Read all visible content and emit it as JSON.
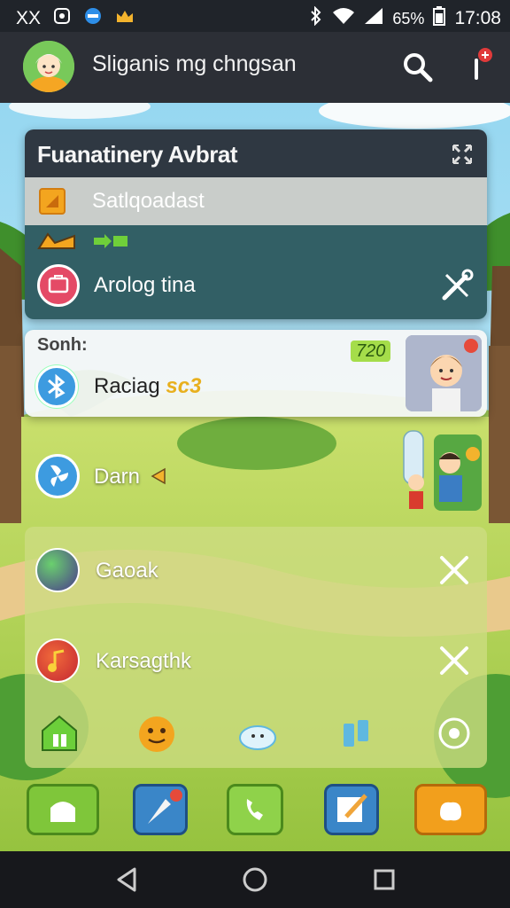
{
  "status_bar": {
    "carrier": "XX",
    "battery_percent": "65%",
    "time": "17:08"
  },
  "app_bar": {
    "title": "Sliganis mg chngsan",
    "search_icon": "search-icon",
    "more_icon": "more-vert-icon"
  },
  "panel_primary": {
    "title": "Fuanatinery Avbrat",
    "close_icon": "expand-collapse-icon",
    "subheader": {
      "icon": "folder-icon",
      "label": "Satlqoadast"
    },
    "row": {
      "icon": "briefcase-icon",
      "label": "Arolog tina",
      "tool_icon": "tools-icon"
    }
  },
  "panel_secondary": {
    "section_label": "Sonh:",
    "row_label": "Raciag",
    "row_badge": "sc3",
    "count": "720"
  },
  "free_row": {
    "label": "Darn"
  },
  "panel_list": {
    "items": [
      {
        "label": "Gaoak"
      },
      {
        "label": "Karsagthk"
      }
    ],
    "toolbar": [
      "home-add-icon",
      "smiley-icon",
      "cloud-icon",
      "book-icon",
      "settings-circle-icon"
    ]
  },
  "dock": [
    "chat-icon",
    "rocket-icon",
    "phone-icon",
    "compose-icon",
    "gift-icon"
  ],
  "nav": [
    "back-icon",
    "home-icon",
    "recents-icon"
  ],
  "colors": {
    "status_bar": "#20242a",
    "app_bar": "#2c2f36",
    "accent_green": "#7fc63a",
    "accent_orange": "#f29f1c"
  }
}
